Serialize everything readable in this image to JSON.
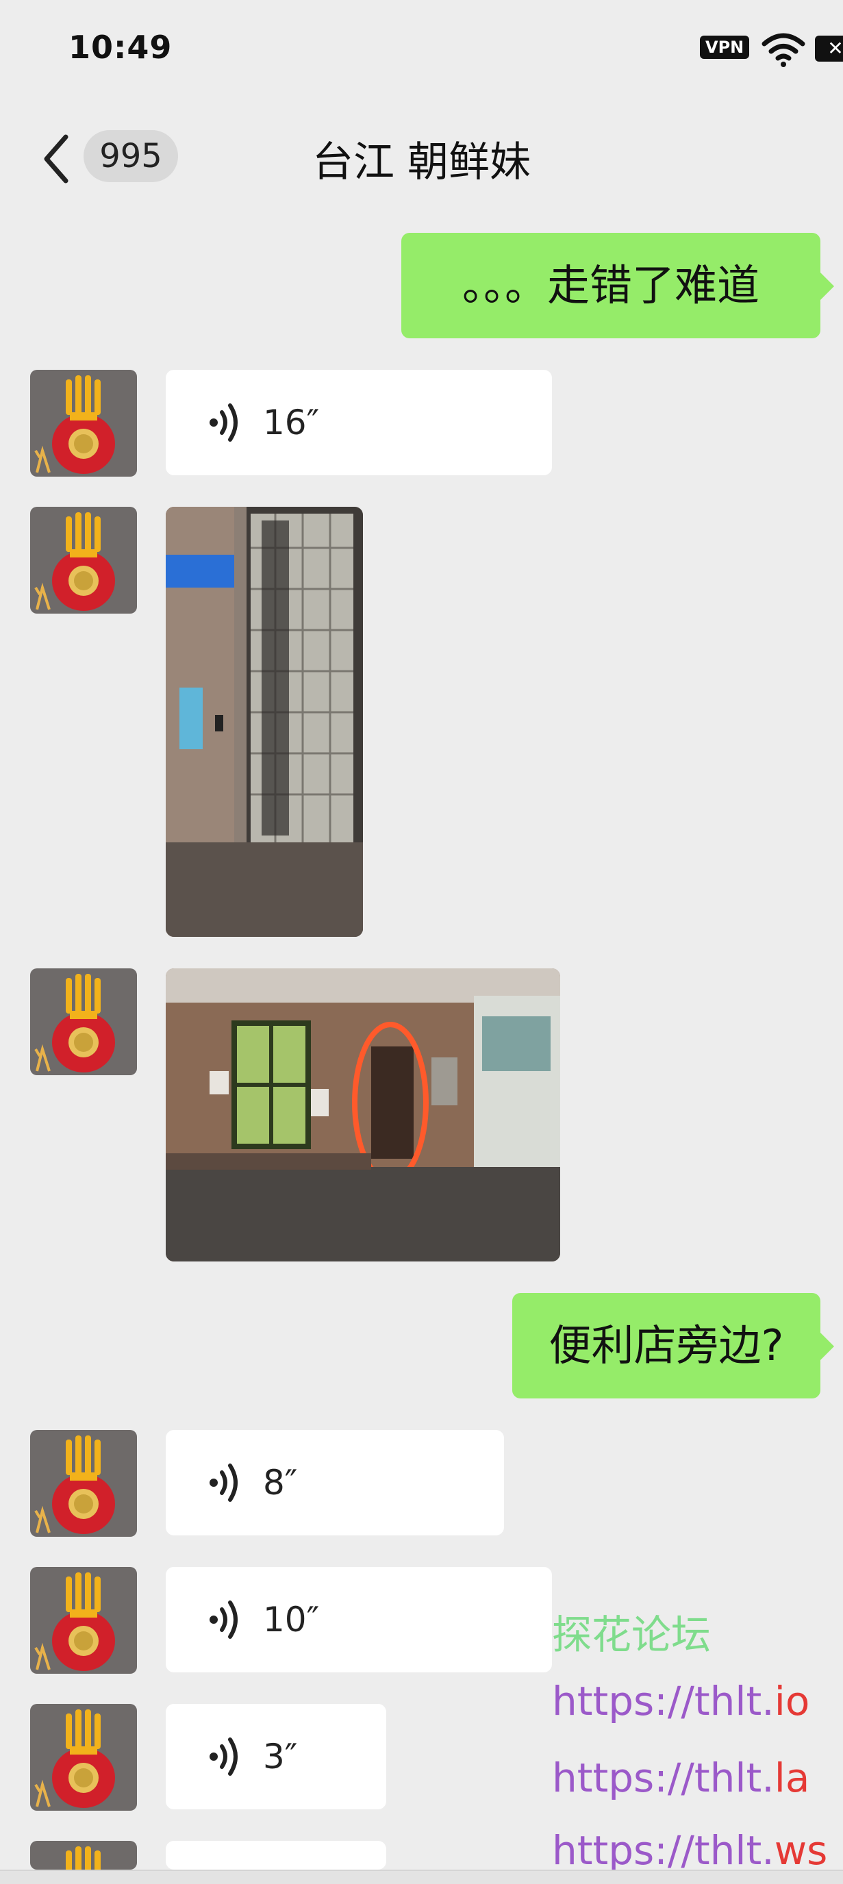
{
  "status_bar": {
    "time": "10:49",
    "vpn_label": "VPN",
    "battery_icon": "battery-close-icon"
  },
  "header": {
    "back_icon": "chevron-left-icon",
    "unread_count": "995",
    "title": "台江 朝鲜妹"
  },
  "messages": [
    {
      "type": "text",
      "direction": "out",
      "text": "。。。走错了难道"
    },
    {
      "type": "voice",
      "direction": "in",
      "duration": "16″"
    },
    {
      "type": "image",
      "direction": "in",
      "subject": "building entrance door with blue sign"
    },
    {
      "type": "image",
      "direction": "in",
      "subject": "building lobby with circled doorway"
    },
    {
      "type": "text",
      "direction": "out",
      "text": "便利店旁边?"
    },
    {
      "type": "voice",
      "direction": "in",
      "duration": "8″"
    },
    {
      "type": "voice",
      "direction": "in",
      "duration": "10″"
    },
    {
      "type": "voice",
      "direction": "in",
      "duration": "3″"
    }
  ],
  "watermark": {
    "name": "探花论坛",
    "link1_base": "https://thlt.",
    "link1_tld": "io",
    "link2_base": "https://thlt.",
    "link2_tld": "la",
    "link3_base": "https://thlt.",
    "link3_tld": "ws",
    "colors": {
      "name": "#7fdc8c",
      "link": "#9b59c9",
      "tld": "#e53935"
    }
  }
}
